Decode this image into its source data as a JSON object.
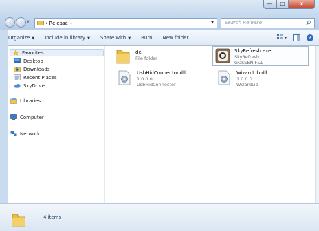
{
  "window": {
    "controls": {
      "minimize": "—",
      "maximize": "□",
      "close": "x"
    }
  },
  "nav": {
    "back": "‹",
    "forward": "›",
    "dropdown": "▼"
  },
  "address": {
    "breadcrumb": [
      "Release"
    ],
    "separator": "▸",
    "refresh": "↻"
  },
  "search": {
    "placeholder": "Search Release"
  },
  "toolbar": {
    "organize": "Organize",
    "include_in_library": "Include in library",
    "share_with": "Share with",
    "burn": "Burn",
    "new_folder": "New folder",
    "dropdown_glyph": "▼",
    "help_glyph": "?"
  },
  "sidebar": {
    "favorites": {
      "label": "Favorites",
      "items": [
        {
          "label": "Desktop"
        },
        {
          "label": "Downloads"
        },
        {
          "label": "Recent Places"
        },
        {
          "label": "SkyDrive"
        }
      ]
    },
    "libraries": "Libraries",
    "computer": "Computer",
    "network": "Network"
  },
  "files": [
    {
      "name": "de",
      "line2": "File folder",
      "line3": "",
      "icon": "folder-icon"
    },
    {
      "name": "SkyRefresh.exe",
      "line2": "SkyRefresh",
      "line3": "GOSSEN F&L",
      "icon": "application-icon"
    },
    {
      "name": "UsbHidConnector.dll",
      "line2": "1.0.0.0",
      "line3": "UsbHidConnector",
      "icon": "dll-gear-icon"
    },
    {
      "name": "WizardLib.dll",
      "line2": "1.0.0.0",
      "line3": "WizardLib",
      "icon": "dll-gear-icon"
    }
  ],
  "status": {
    "item_count": "4 items"
  },
  "colors": {
    "titlebar": "#c4d8ee",
    "toolbar": "#dfe9f5",
    "folder": "#e8c45a",
    "accent": "#2c6bc0"
  }
}
